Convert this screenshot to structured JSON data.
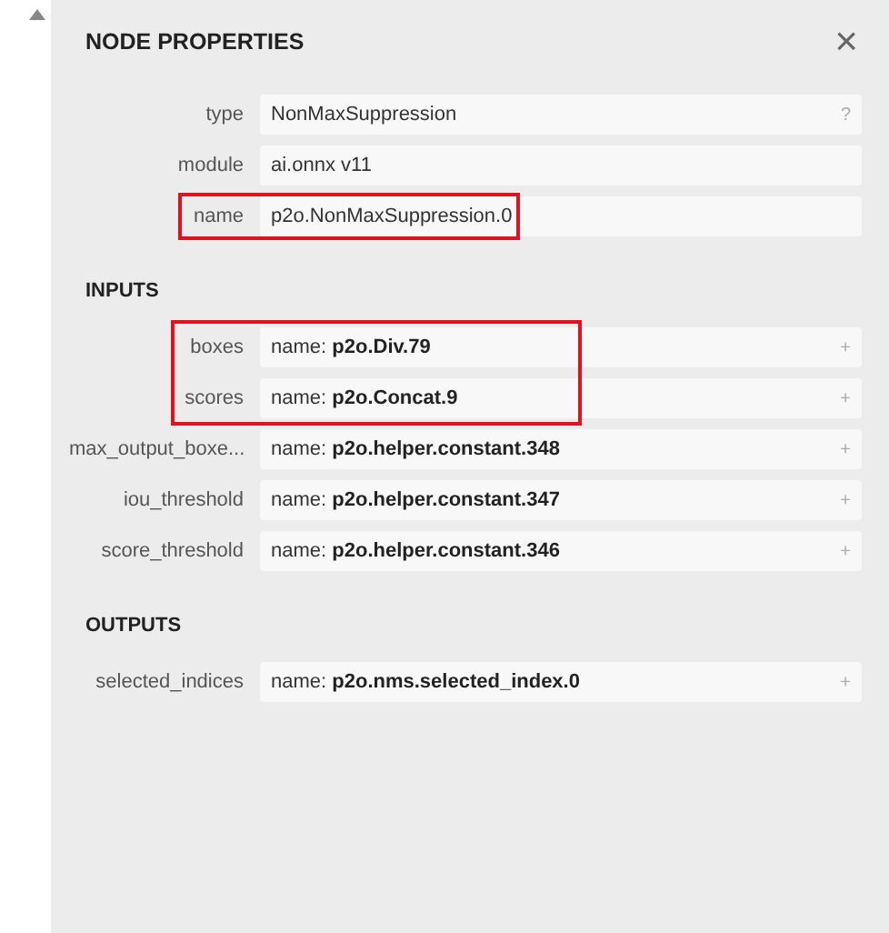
{
  "panel": {
    "title": "NODE PROPERTIES",
    "close": "×"
  },
  "attributes": [
    {
      "label": "type",
      "value": "NonMaxSuppression",
      "action": "?",
      "highlighted": false
    },
    {
      "label": "module",
      "value": "ai.onnx v11",
      "highlighted": false
    },
    {
      "label": "name",
      "value": "p2o.NonMaxSuppression.0",
      "highlighted": true
    }
  ],
  "sections": [
    {
      "title": "INPUTS",
      "items": [
        {
          "label": "boxes",
          "prefix": "name:",
          "value": "p2o.Div.79",
          "action": "+",
          "highlighted": true
        },
        {
          "label": "scores",
          "prefix": "name:",
          "value": "p2o.Concat.9",
          "action": "+",
          "highlighted": true
        },
        {
          "label": "max_output_boxe...",
          "prefix": "name:",
          "value": "p2o.helper.constant.348",
          "action": "+",
          "highlighted": false
        },
        {
          "label": "iou_threshold",
          "prefix": "name:",
          "value": "p2o.helper.constant.347",
          "action": "+",
          "highlighted": false
        },
        {
          "label": "score_threshold",
          "prefix": "name:",
          "value": "p2o.helper.constant.346",
          "action": "+",
          "highlighted": false
        }
      ]
    },
    {
      "title": "OUTPUTS",
      "items": [
        {
          "label": "selected_indices",
          "prefix": "name:",
          "value": "p2o.nms.selected_index.0",
          "action": "+",
          "highlighted": false
        }
      ]
    }
  ]
}
